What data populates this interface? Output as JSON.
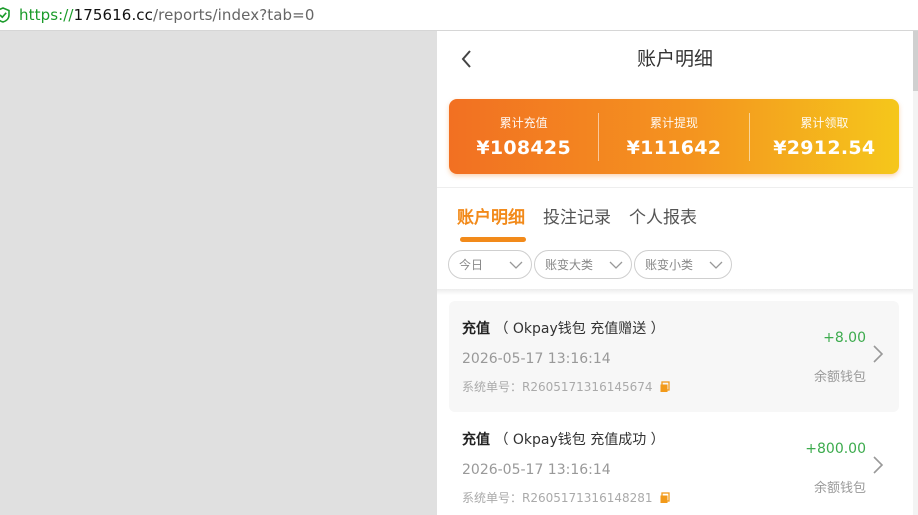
{
  "browser": {
    "url_scheme": "https://",
    "url_host": "175616.cc",
    "url_path": "/reports/index?tab=0"
  },
  "header": {
    "title": "账户明细"
  },
  "summary": [
    {
      "label": "累计充值",
      "value": "¥108425"
    },
    {
      "label": "累计提现",
      "value": "¥111642"
    },
    {
      "label": "累计领取",
      "value": "¥2912.54"
    }
  ],
  "tabs": [
    {
      "label": "账户明细",
      "active": true
    },
    {
      "label": "投注记录",
      "active": false
    },
    {
      "label": "个人报表",
      "active": false
    }
  ],
  "filters": [
    {
      "label": "今日"
    },
    {
      "label": "账变大类"
    },
    {
      "label": "账变小类"
    }
  ],
  "records": [
    {
      "type": "充值",
      "detail": "（ Okpay钱包 充值赠送 ）",
      "time": "2026-05-17 13:16:14",
      "order_label": "系统单号：",
      "order_no": "R2605171316145674",
      "amount": "+8.00",
      "wallet": "余额钱包"
    },
    {
      "type": "充值",
      "detail": "（ Okpay钱包 充值成功 ）",
      "time": "2026-05-17 13:16:14",
      "order_label": "系统单号：",
      "order_no": "R2605171316148281",
      "amount": "+800.00",
      "wallet": "余额钱包"
    }
  ],
  "colors": {
    "accent": "#f28a1a",
    "positive": "#3cab4d",
    "gradient_start": "#f27022",
    "gradient_end": "#f5c71b"
  },
  "icons": {
    "back": "chevron-left-icon",
    "filter": "chevron-down-icon",
    "record": "chevron-right-icon",
    "copy": "copy-icon",
    "security": "shield-check-icon"
  }
}
